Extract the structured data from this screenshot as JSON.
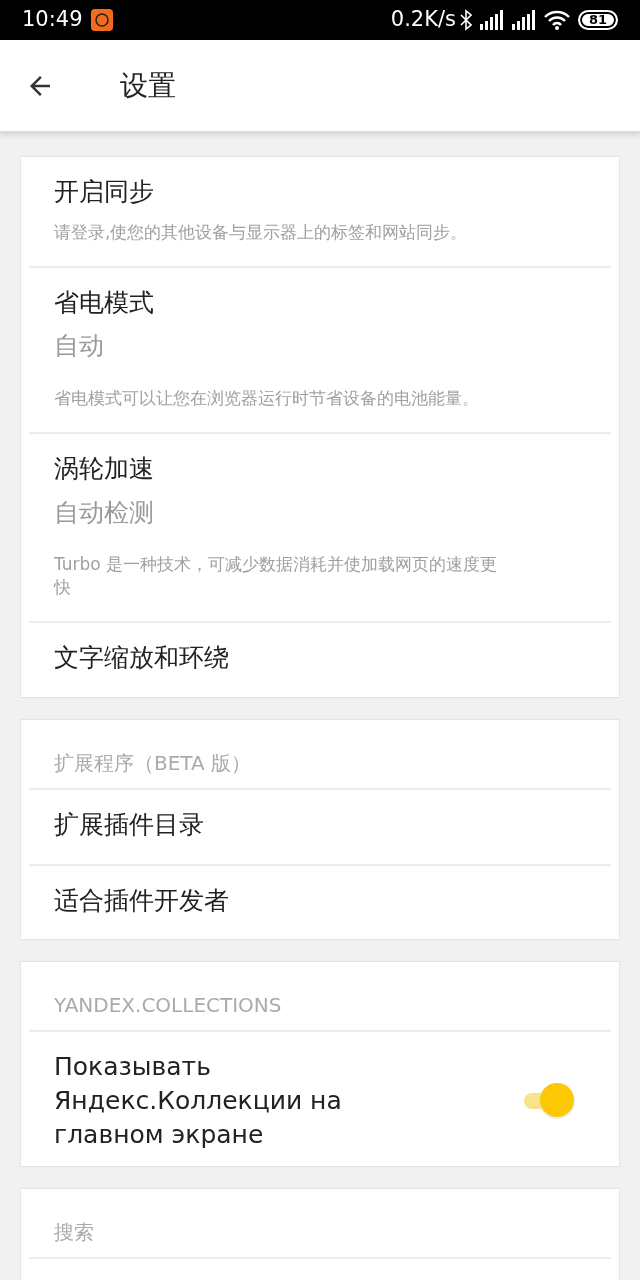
{
  "status_bar": {
    "time": "10:49",
    "speed": "0.2K/s",
    "battery": "81"
  },
  "app_bar": {
    "title": "设置"
  },
  "sections": [
    {
      "items": [
        {
          "kind": "item",
          "title": "开启同步",
          "description": "请登录,使您的其他设备与显示器上的标签和网站同步。"
        },
        {
          "kind": "item",
          "title": "省电模式",
          "value": "自动",
          "description": "省电模式可以让您在浏览器运行时节省设备的电池能量。"
        },
        {
          "kind": "item",
          "title": "涡轮加速",
          "value": "自动检测",
          "description": "Turbo 是一种技术，可减少数据消耗并使加载网页的速度更快"
        },
        {
          "kind": "item",
          "title": "文字缩放和环绕"
        }
      ]
    },
    {
      "header": "扩展程序（BETA 版）",
      "items": [
        {
          "kind": "item",
          "title": "扩展插件目录"
        },
        {
          "kind": "item",
          "title": "适合插件开发者"
        }
      ]
    },
    {
      "header": "YANDEX.COLLECTIONS",
      "items": [
        {
          "kind": "toggle",
          "title": "Показывать Яндекс.Коллекции на главном экране",
          "on": true
        }
      ]
    },
    {
      "header": "搜索"
    }
  ]
}
